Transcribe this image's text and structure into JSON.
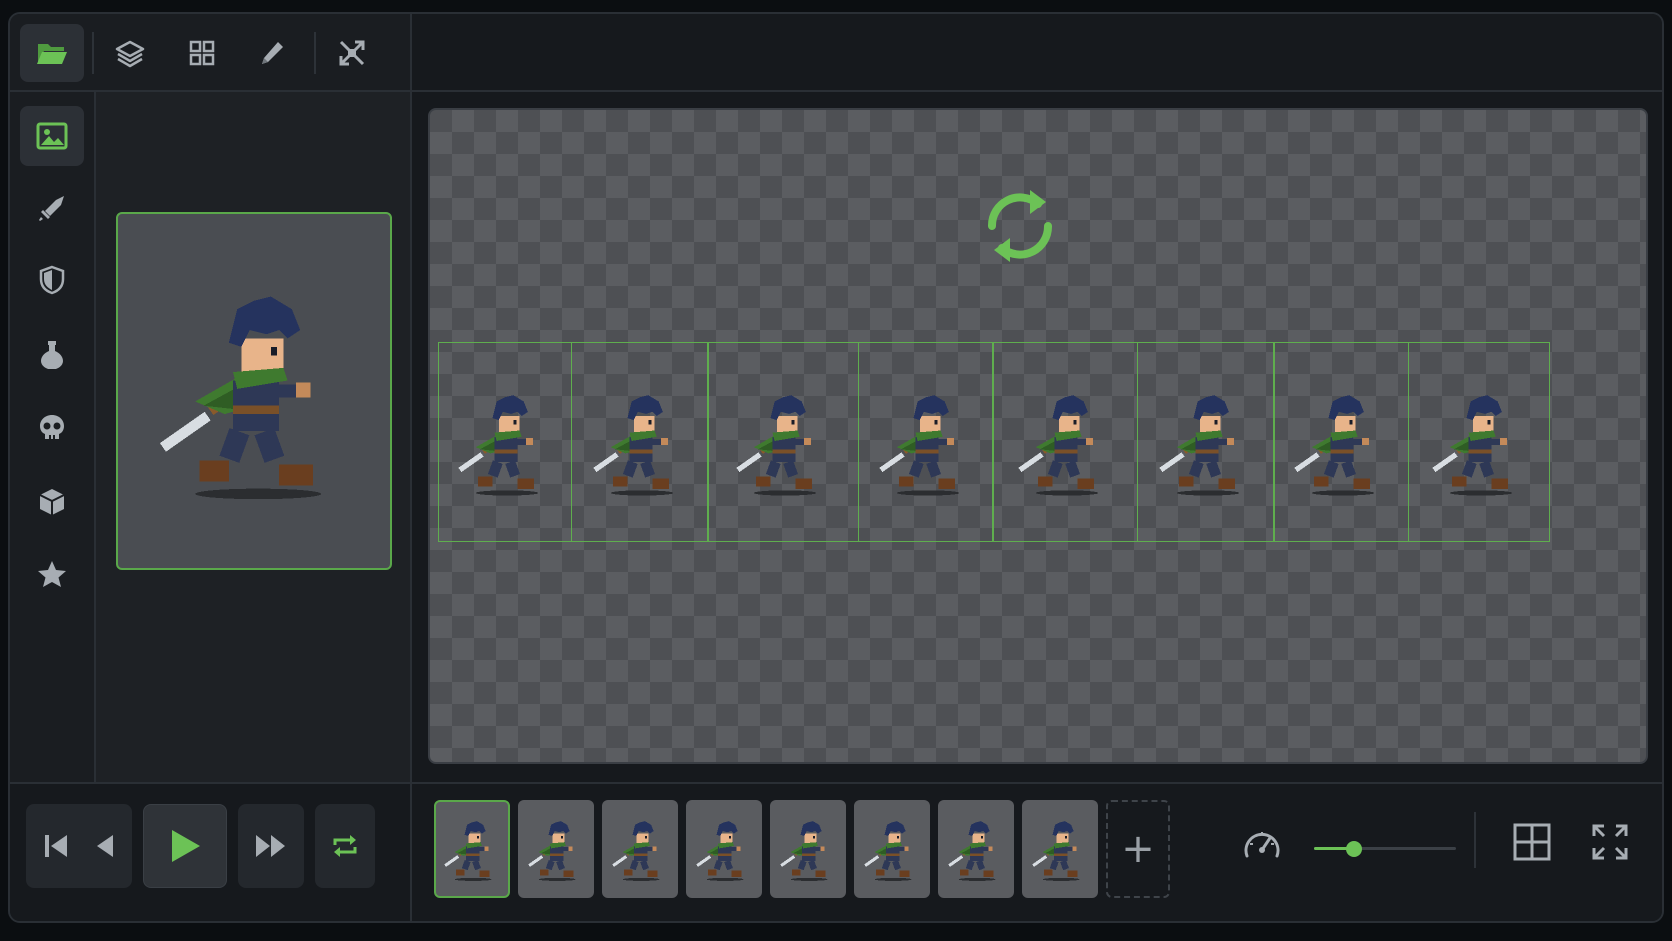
{
  "toolbar": {
    "buttons": [
      {
        "icon": "folder-open-icon",
        "active": true
      },
      {
        "icon": "layers-icon",
        "active": false
      },
      {
        "icon": "grid-icon",
        "active": false
      },
      {
        "icon": "pencil-icon",
        "active": false
      },
      {
        "icon": "tools-cross-icon",
        "active": false
      }
    ]
  },
  "sidebar": {
    "items": [
      {
        "icon": "image-icon",
        "active": true
      },
      {
        "icon": "sword-icon",
        "active": false
      },
      {
        "icon": "shield-icon",
        "active": false
      },
      {
        "icon": "potion-flask-icon",
        "active": false
      },
      {
        "icon": "skull-icon",
        "active": false
      },
      {
        "icon": "cube-icon",
        "active": false
      },
      {
        "icon": "star-icon",
        "active": false
      }
    ]
  },
  "preview": {
    "sprite": "hero-run-sprite"
  },
  "canvas": {
    "loop_icon": "loop-refresh-icon",
    "frame_count": 8
  },
  "playback": {
    "buttons": [
      "skip-to-start-icon",
      "step-back-icon",
      "play-icon",
      "fast-forward-icon",
      "loop-toggle-icon"
    ]
  },
  "timeline": {
    "thumb_count": 8,
    "selected_index": 0,
    "add_label": "+"
  },
  "speed": {
    "icon": "speedometer-icon",
    "level": 0.28
  },
  "view_buttons": [
    "grid-view-icon",
    "fullscreen-icon"
  ],
  "colors": {
    "accent": "#6cc256",
    "frame_border": "#5fae4e",
    "icon": "#a7adb3"
  }
}
